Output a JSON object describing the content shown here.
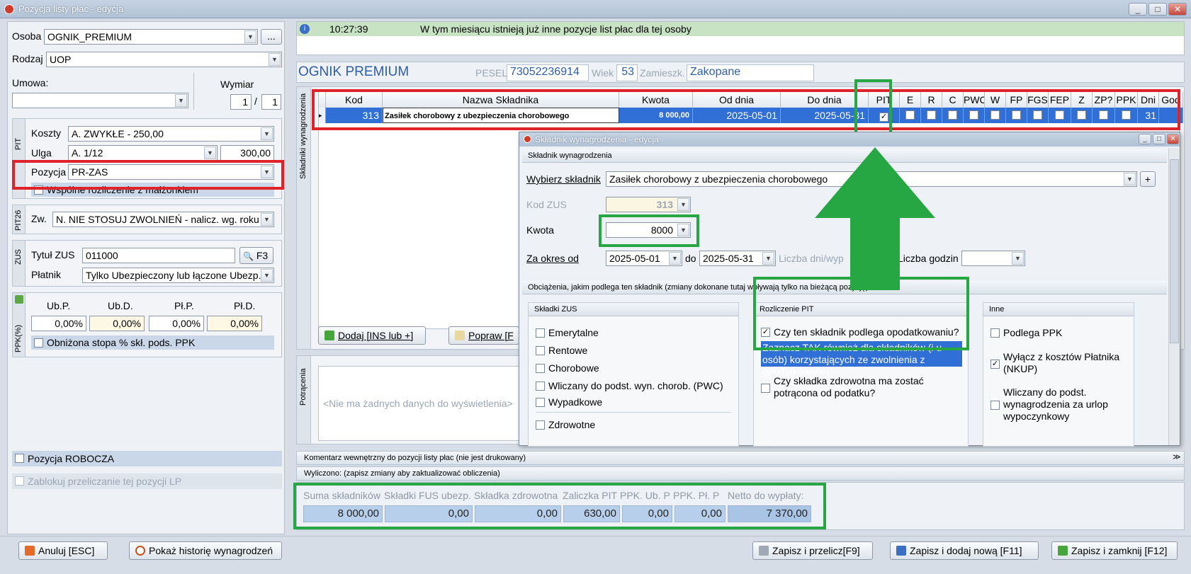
{
  "window": {
    "title": "Pozycja listy płac - edycja"
  },
  "left": {
    "osoba_label": "Osoba",
    "osoba_value": "OGNIK_PREMIUM",
    "osoba_btn": "...",
    "rodzaj_label": "Rodzaj",
    "rodzaj_value": "UOP",
    "umowa_label": "Umowa:",
    "wymiar_label": "Wymiar",
    "wymiar_num": "1",
    "wymiar_sep": "/",
    "wymiar_den": "1",
    "pit_tab": "PIT",
    "koszty_label": "Koszty",
    "koszty_value": "A. ZWYKŁE - 250,00",
    "ulga_label": "Ulga",
    "ulga_value": "A. 1/12",
    "ulga_amount": "300,00",
    "pozycja_label": "Pozycja",
    "pozycja_value": "PR-ZAS",
    "wspolne_label": "Wspólne rozliczenie z małżonkiem",
    "pit26_tab": "PIT26",
    "zw_label": "Zw.",
    "zw_value": "N. NIE STOSUJ ZWOLNIEŃ - nalicz. wg. roku",
    "zus_tab": "ZUS",
    "tytul_label": "Tytuł ZUS",
    "tytul_value": "011000",
    "f3_label": "F3",
    "platnik_label": "Płatnik",
    "platnik_value": "Tylko Ubezpieczony lub łączone Ubezp.",
    "ppk_tab": "PPK(%)",
    "ppk_headers": [
      "Ub.P.",
      "Ub.D.",
      "Pł.P.",
      "Pł.D."
    ],
    "ppk_values": [
      "0,00%",
      "0,00%",
      "0,00%",
      "0,00%"
    ],
    "obnizona_label": "Obniżona stopa % skł. pods. PPK",
    "robocza_label": "Pozycja ROBOCZA",
    "zablokuj_label": "Zablokuj przeliczanie tej pozycji LP"
  },
  "info": {
    "time": "10:27:39",
    "message": "W tym miesiącu istnieją już inne pozycje list płac dla tej osoby"
  },
  "person": {
    "name": "OGNIK PREMIUM",
    "pesel_label": "PESEL",
    "pesel": "73052236914",
    "wiek_label": "Wiek",
    "wiek": "53",
    "zam_label": "Zamieszk.",
    "zam": "Zakopane"
  },
  "grid": {
    "side_tab": "Składniki wynagrodzenia",
    "headers": [
      "Kod",
      "Nazwa Składnika",
      "Kwota",
      "Od dnia",
      "Do dnia",
      "PIT",
      "E",
      "R",
      "C",
      "PWC",
      "W",
      "FP",
      "FGS",
      "FEP",
      "Z",
      "ZP?",
      "PPK",
      "Dni",
      "God"
    ],
    "row": {
      "kod": "313",
      "nazwa": "Zasiłek chorobowy z ubezpieczenia chorobowego",
      "kwota": "8 000,00",
      "od": "2025-05-01",
      "do": "2025-05-31",
      "dni": "31"
    },
    "add_btn": "Dodaj [INS lub +]",
    "edit_btn": "Popraw [F"
  },
  "potracenia": {
    "side_tab": "Potrącenia",
    "empty": "<Nie ma żadnych danych do wyświetlenia>"
  },
  "dialog": {
    "title": "Składnik wynagrodzenia - edycja",
    "section1": "Składnik wynagrodzenia",
    "wybierz_label": "Wybierz składnik",
    "wybierz_value": "Zasiłek chorobowy z ubezpieczenia chorobowego",
    "plus": "+",
    "kod_label": "Kod ZUS",
    "kod_value": "313",
    "kwota_label": "Kwota",
    "kwota_value": "8000",
    "okres_label": "Za okres od",
    "od_value": "2025-05-01",
    "do_label": "do",
    "do_value": "2025-05-31",
    "liczba_dni_label": "Liczba dni/wyp",
    "liczba_godzin_label": "Liczba godzin",
    "section2": "Obciążenia, jakim podlega ten składnik (zmiany dokonane tutaj wpływają tylko na bieżącą pozycję)",
    "zus_header": "Składki ZUS",
    "zus_items": [
      "Emerytalne",
      "Rentowe",
      "Chorobowe",
      "Wliczany do podst. wyn. chorob. (PWC)",
      "Wypadkowe",
      "Zdrowotne"
    ],
    "pit_header": "Rozliczenie PIT",
    "pit_q1": "Czy ten składnik podlega opodatkowaniu?",
    "pit_hint": "Zaznacz TAK również dla składników (i u osób) korzystających ze zwolnienia z opodatkowania",
    "pit_q2": "Czy składka zdrowotna ma zostać potrącona od podatku?",
    "inne_header": "Inne",
    "inne_items": [
      "Podlega PPK",
      "Wyłącz z kosztów Płatnika (NKUP)",
      "Wliczany do podst. wynagrodzenia za urlop wypoczynkowy"
    ]
  },
  "bottom": {
    "komentarz": "Komentarz wewnętrzny do pozycji listy płac (nie jest drukowany)",
    "wyliczono": "Wyliczono: (zapisz zmiany aby zaktualizować obliczenia)",
    "sum_headers": [
      "Suma składników",
      "Składki FUS ubezp.",
      "Składka zdrowotna",
      "Zaliczka PIT",
      "PPK. Ub. P",
      "PPK. Pł. P",
      "Netto do wypłaty:"
    ],
    "sum_values": [
      "8 000,00",
      "0,00",
      "0,00",
      "630,00",
      "0,00",
      "0,00",
      "7 370,00"
    ],
    "anuluj": "Anuluj [ESC]",
    "historia": "Pokaż historię wynagrodzeń",
    "zapisz_przelicz": "Zapisz i przelicz[F9]",
    "zapisz_dodaj": "Zapisz i dodaj nową [F11]",
    "zapisz_zamknij": "Zapisz i zamknij [F12]"
  },
  "colors": {
    "accent": "#2f6fd6",
    "highlight_red": "#e0232a",
    "highlight_green": "#27a744",
    "info_bar": "#c7e3c3"
  }
}
